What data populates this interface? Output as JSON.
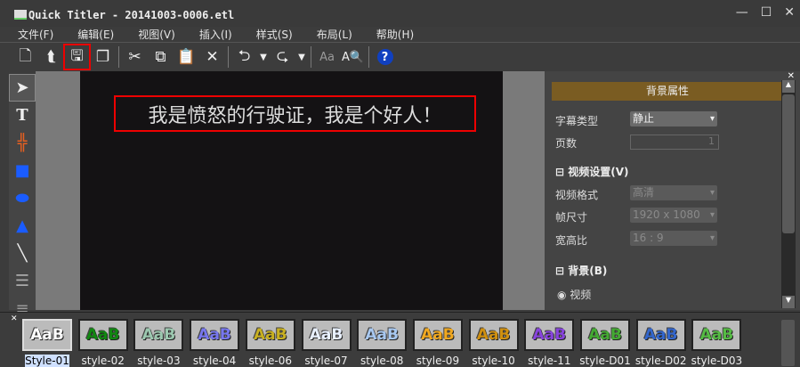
{
  "window": {
    "title": "Quick Titler - 20141003-0006.etl",
    "controls": [
      "—",
      "☐",
      "✕"
    ]
  },
  "menu": [
    "文件(F)",
    "编辑(E)",
    "视图(V)",
    "插入(I)",
    "样式(S)",
    "布局(L)",
    "帮助(H)"
  ],
  "canvas": {
    "caption": "我是愤怒的行驶证，我是个好人！"
  },
  "panel": {
    "title": "背景属性",
    "caption_type_label": "字幕类型",
    "caption_type_value": "静止",
    "pages_label": "页数",
    "pages_value": "1",
    "video_section": "视频设置(V)",
    "format_label": "视频格式",
    "format_value": "高清",
    "frame_label": "帧尺寸",
    "frame_value": "1920 x 1080",
    "aspect_label": "宽高比",
    "aspect_value": "16 : 9",
    "bg_section": "背景(B)",
    "bg_option": "视频"
  },
  "styles": [
    {
      "label": "Style-01",
      "color": "#ffffff"
    },
    {
      "label": "style-02",
      "color": "#118811"
    },
    {
      "label": "style-03",
      "color": "#9cc8b0"
    },
    {
      "label": "style-04",
      "color": "#7777ee"
    },
    {
      "label": "style-06",
      "color": "#c8b020"
    },
    {
      "label": "style-07",
      "color": "#e8f0ff"
    },
    {
      "label": "style-08",
      "color": "#a8c8f0"
    },
    {
      "label": "style-09",
      "color": "#f0a820"
    },
    {
      "label": "style-10",
      "color": "#d09010"
    },
    {
      "label": "style-11",
      "color": "#8844dd"
    },
    {
      "label": "style-D01",
      "color": "#44aa33"
    },
    {
      "label": "style-D02",
      "color": "#3366cc"
    },
    {
      "label": "style-D03",
      "color": "#55bb44"
    }
  ],
  "style_sample": "AaB"
}
